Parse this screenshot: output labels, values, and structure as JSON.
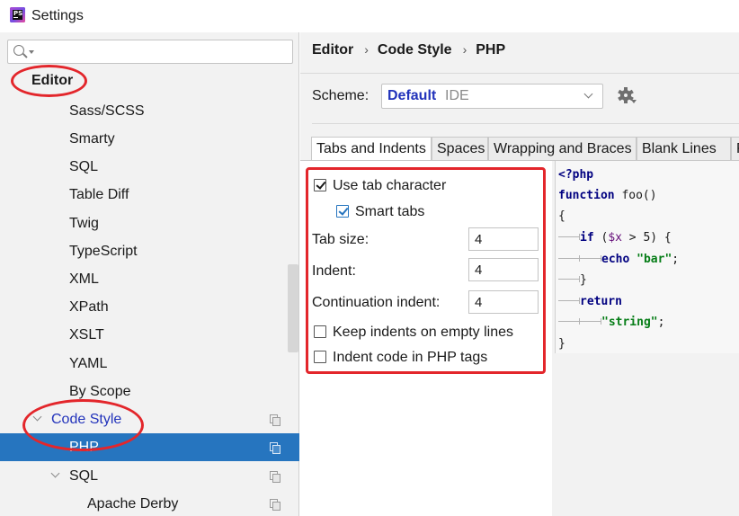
{
  "window": {
    "title": "Settings",
    "app_icon": "phpstorm-logo"
  },
  "search": {
    "value": "",
    "placeholder": ""
  },
  "tree": {
    "items": [
      {
        "label": "Editor",
        "bold": true
      },
      {
        "label": "Sass/SCSS"
      },
      {
        "label": "Smarty"
      },
      {
        "label": "SQL"
      },
      {
        "label": "Table Diff"
      },
      {
        "label": "Twig"
      },
      {
        "label": "TypeScript"
      },
      {
        "label": "XML"
      },
      {
        "label": "XPath"
      },
      {
        "label": "XSLT"
      },
      {
        "label": "YAML"
      },
      {
        "label": "By Scope"
      },
      {
        "label": "Code Style",
        "expanded": true,
        "link": true
      },
      {
        "label": "PHP",
        "selected": true
      },
      {
        "label": "SQL",
        "expanded": true
      },
      {
        "label": "Apache Derby"
      }
    ]
  },
  "breadcrumb": {
    "part1": "Editor",
    "part2": "Code Style",
    "part3": "PHP",
    "separator": "›"
  },
  "scheme": {
    "label": "Scheme:",
    "value": "Default",
    "sub": "IDE"
  },
  "tabs": [
    "Tabs and Indents",
    "Spaces",
    "Wrapping and Braces",
    "Blank Lines",
    "PHPDoc"
  ],
  "active_tab": "Tabs and Indents",
  "options": {
    "use_tab": {
      "label": "Use tab character",
      "checked": true
    },
    "smart_tabs": {
      "label": "Smart tabs",
      "checked": true
    },
    "tab_size": {
      "label": "Tab size:",
      "value": "4"
    },
    "indent": {
      "label": "Indent:",
      "value": "4"
    },
    "continuation": {
      "label": "Continuation indent:",
      "value": "4"
    },
    "keep_indents": {
      "label": "Keep indents on empty lines",
      "checked": false
    },
    "indent_php": {
      "label": "Indent code in PHP tags",
      "checked": false
    }
  },
  "preview": {
    "l1": "<?php",
    "l2_kw": "function",
    "l2_rest": " foo()",
    "l3": "{",
    "l4_kw": "if",
    "l4_a": " (",
    "l4_var": "$x",
    "l4_b": " > 5) {",
    "l5_kw": "echo",
    "l5_str": "\"bar\"",
    "l5_end": ";",
    "l6": "}",
    "l7_kw": "return",
    "l8_str": "\"string\"",
    "l8_end": ";",
    "l9": "}"
  },
  "colors": {
    "selection": "#2675bf",
    "highlight_ring": "#e3262b",
    "link": "#2233bb"
  }
}
